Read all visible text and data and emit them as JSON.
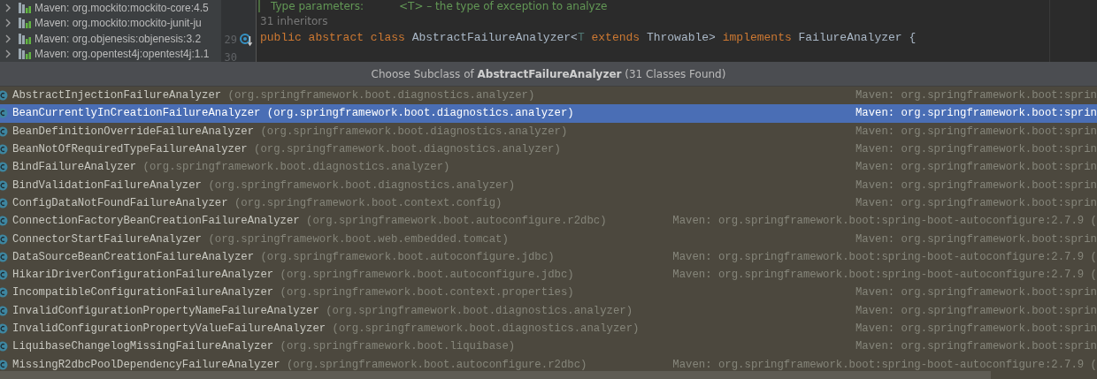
{
  "project_tree": {
    "items": [
      {
        "label": "Maven: org.mockito:mockito-core:4.5",
        "expanded": false
      },
      {
        "label": "Maven: org.mockito:mockito-junit-ju",
        "expanded": false
      },
      {
        "label": "Maven: org.objenesis:objenesis:3.2",
        "expanded": false
      },
      {
        "label": "Maven: org.opentest4j:opentest4j:1.1",
        "expanded": false
      }
    ]
  },
  "editor": {
    "doc_comment": [
      {
        "text": "Type parameters:",
        "kind": "tag"
      },
      {
        "text": "<T> – the type of exception to analyze",
        "kind": "text"
      }
    ],
    "inheritors_hint": "31 inheritors",
    "lines": [
      {
        "number": "29",
        "marker": true,
        "tokens": [
          {
            "text": "public abstract class ",
            "kind": "keyword"
          },
          {
            "text": "AbstractFailureAnalyzer<",
            "kind": "name"
          },
          {
            "text": "T",
            "kind": "type_param"
          },
          {
            "text": " extends ",
            "kind": "keyword"
          },
          {
            "text": "Throwable> ",
            "kind": "name"
          },
          {
            "text": "implements ",
            "kind": "keyword"
          },
          {
            "text": "FailureAnalyzer {",
            "kind": "name"
          }
        ]
      },
      {
        "number": "30"
      }
    ]
  },
  "popup": {
    "title": "Choose Subclass of **AbstractFailureAnalyzer** (31 Classes Found)",
    "rows": [
      {
        "name": "AbstractInjectionFailureAnalyzer",
        "package": "(org.springframework.boot.diagnostics.analyzer)",
        "module": "Maven: org.springframework.boot:sprin",
        "selected": false
      },
      {
        "name": "BeanCurrentlyInCreationFailureAnalyzer",
        "package": "(org.springframework.boot.diagnostics.analyzer)",
        "module": "Maven: org.springframework.boot:sprin",
        "selected": true
      },
      {
        "name": "BeanDefinitionOverrideFailureAnalyzer",
        "package": "(org.springframework.boot.diagnostics.analyzer)",
        "module": "Maven: org.springframework.boot:sprin",
        "selected": false
      },
      {
        "name": "BeanNotOfRequiredTypeFailureAnalyzer",
        "package": "(org.springframework.boot.diagnostics.analyzer)",
        "module": "Maven: org.springframework.boot:sprin",
        "selected": false
      },
      {
        "name": "BindFailureAnalyzer",
        "package": "(org.springframework.boot.diagnostics.analyzer)",
        "module": "Maven: org.springframework.boot:sprin",
        "selected": false
      },
      {
        "name": "BindValidationFailureAnalyzer",
        "package": "(org.springframework.boot.diagnostics.analyzer)",
        "module": "Maven: org.springframework.boot:sprin",
        "selected": false
      },
      {
        "name": "ConfigDataNotFoundFailureAnalyzer",
        "package": "(org.springframework.boot.context.config)",
        "module": "Maven: org.springframework.boot:sprin",
        "selected": false
      },
      {
        "name": "ConnectionFactoryBeanCreationFailureAnalyzer",
        "package": "(org.springframework.boot.autoconfigure.r2dbc)",
        "module": "Maven: org.springframework.boot:spring-boot-autoconfigure:2.7.9 (",
        "selected": false
      },
      {
        "name": "ConnectorStartFailureAnalyzer",
        "package": "(org.springframework.boot.web.embedded.tomcat)",
        "module": "Maven: org.springframework.boot:sprin",
        "selected": false
      },
      {
        "name": "DataSourceBeanCreationFailureAnalyzer",
        "package": "(org.springframework.boot.autoconfigure.jdbc)",
        "module": "Maven: org.springframework.boot:spring-boot-autoconfigure:2.7.9 (",
        "selected": false
      },
      {
        "name": "HikariDriverConfigurationFailureAnalyzer",
        "package": "(org.springframework.boot.autoconfigure.jdbc)",
        "module": "Maven: org.springframework.boot:spring-boot-autoconfigure:2.7.9 (",
        "selected": false
      },
      {
        "name": "IncompatibleConfigurationFailureAnalyzer",
        "package": "(org.springframework.boot.context.properties)",
        "module": "Maven: org.springframework.boot:sprin",
        "selected": false
      },
      {
        "name": "InvalidConfigurationPropertyNameFailureAnalyzer",
        "package": "(org.springframework.boot.diagnostics.analyzer)",
        "module": "Maven: org.springframework.boot:sprin",
        "selected": false
      },
      {
        "name": "InvalidConfigurationPropertyValueFailureAnalyzer",
        "package": "(org.springframework.boot.diagnostics.analyzer)",
        "module": "Maven: org.springframework.boot:sprin",
        "selected": false
      },
      {
        "name": "LiquibaseChangelogMissingFailureAnalyzer",
        "package": "(org.springframework.boot.liquibase)",
        "module": "Maven: org.springframework.boot:sprin",
        "selected": false
      },
      {
        "name": "MissingR2dbcPoolDependencyFailureAnalyzer",
        "package": "(org.springframework.boot.autoconfigure.r2dbc)",
        "module": "Maven: org.springframework.boot:spring-boot-autoconfigure:2.7.9 (",
        "selected": false
      }
    ]
  }
}
